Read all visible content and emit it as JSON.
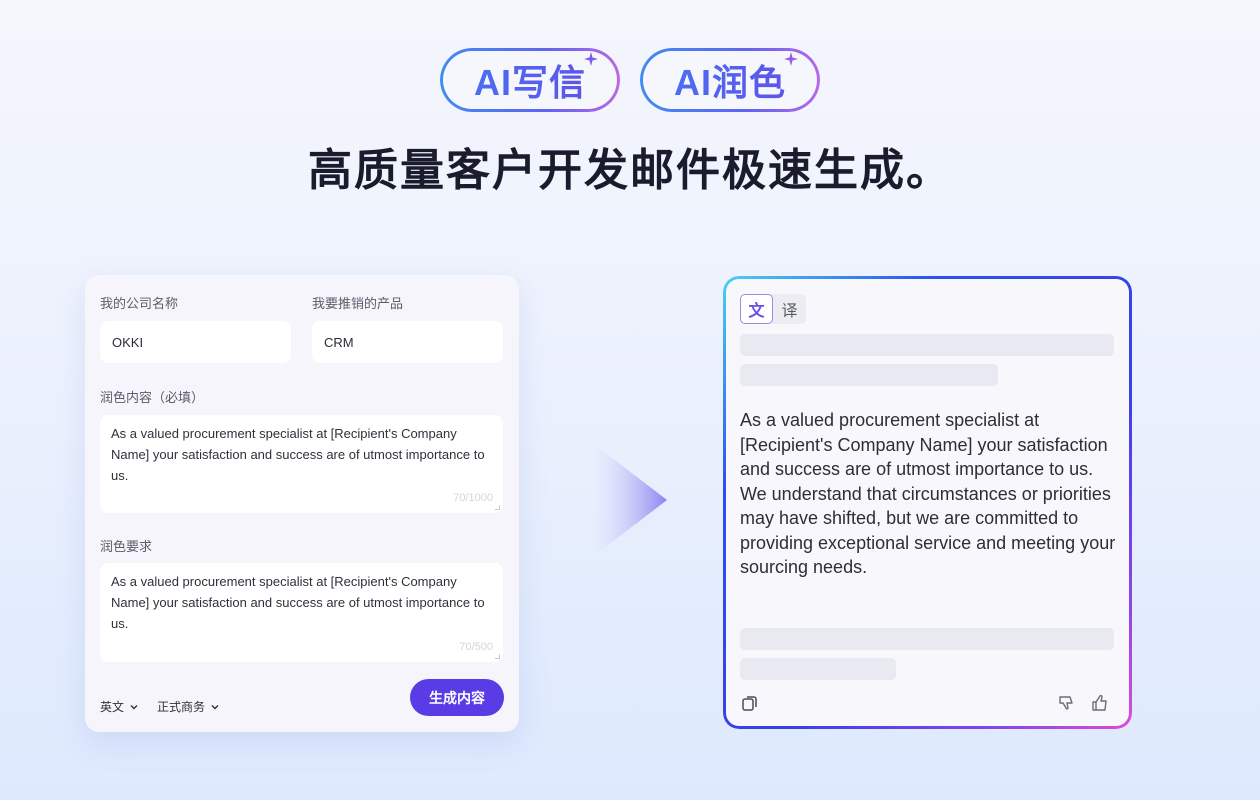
{
  "header": {
    "pills": [
      {
        "label": "AI写信",
        "icon": "sparkle-icon"
      },
      {
        "label": "AI润色",
        "icon": "sparkle-icon"
      }
    ],
    "headline": "高质量客户开发邮件极速生成。"
  },
  "form": {
    "company": {
      "label": "我的公司名称",
      "value": "OKKI"
    },
    "product": {
      "label": "我要推销的产品",
      "value": "CRM"
    },
    "content": {
      "label": "润色内容（必填）",
      "value": "As a valued procurement specialist at [Recipient's Company Name] your satisfaction and success are of utmost importance to us.",
      "counter": "70/1000"
    },
    "requirements": {
      "label": "润色要求",
      "value": "As a valued procurement specialist at [Recipient's Company Name] your satisfaction and success are of utmost importance to us.",
      "counter": "70/500"
    },
    "language_select": {
      "value": "英文",
      "icon": "chevron-down-icon"
    },
    "tone_select": {
      "value": "正式商务",
      "icon": "chevron-down-icon"
    },
    "generate_button": "生成内容"
  },
  "colors": {
    "accent": "#5a3ce6",
    "pill_gradient_start": "#3f8bf5",
    "pill_gradient_end": "#b968e8",
    "border_gradient_start": "#4bd2f2",
    "border_gradient_end": "#e24ad8"
  },
  "result": {
    "toggle": {
      "options": [
        "文",
        "译"
      ],
      "active": "文"
    },
    "text": "As a valued procurement specialist at [Recipient's Company Name] your satisfaction and success are of utmost importance to us. We understand that circumstances or priorities may have shifted, but we are committed to providing exceptional service and meeting your sourcing needs.",
    "actions": {
      "copy": "copy-icon",
      "dislike": "thumbs-down-icon",
      "like": "thumbs-up-icon"
    }
  }
}
